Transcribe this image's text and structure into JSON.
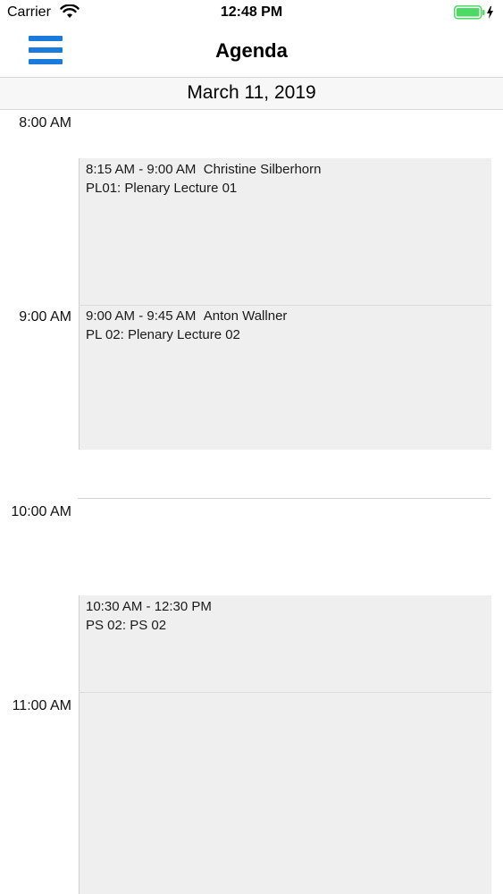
{
  "status_bar": {
    "carrier": "Carrier",
    "time": "12:48 PM"
  },
  "nav": {
    "title": "Agenda",
    "menu_icon": "hamburger-menu-icon",
    "accent_color": "#1a7bdc"
  },
  "date_header": "March 11, 2019",
  "hours": [
    "8:00 AM",
    "9:00 AM",
    "10:00 AM",
    "11:00 AM"
  ],
  "events": [
    {
      "time_range": "8:15 AM - 9:00 AM",
      "speaker": "Christine Silberhorn",
      "title": "PL01: Plenary Lecture 01"
    },
    {
      "time_range": "9:00 AM - 9:45 AM",
      "speaker": "Anton Wallner",
      "title": "PL 02: Plenary Lecture 02"
    },
    {
      "time_range": "10:30 AM - 12:30 PM",
      "speaker": "",
      "title": "PS 02: PS 02"
    }
  ]
}
